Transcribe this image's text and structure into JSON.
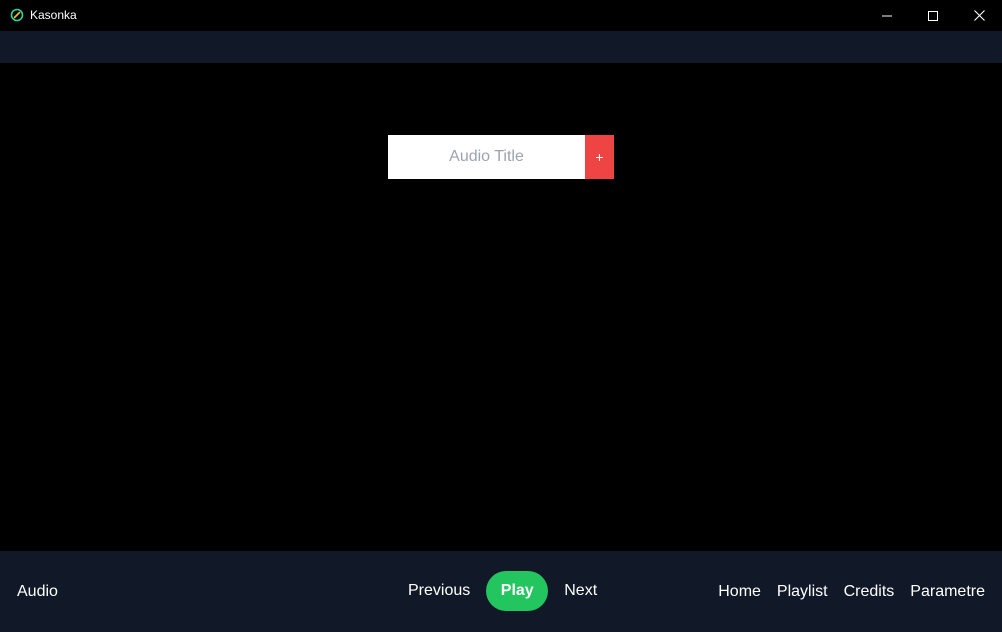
{
  "window": {
    "title": "Kasonka",
    "icon": "app-link-icon",
    "controls": [
      "minimize-icon",
      "maximize-icon",
      "close-icon"
    ]
  },
  "add_form": {
    "title_placeholder": "Audio Title",
    "title_value": "",
    "add_label": "+"
  },
  "bottom_bar": {
    "section_label": "Audio",
    "player": {
      "previous_label": "Previous",
      "play_label": "Play",
      "next_label": "Next"
    },
    "nav": [
      {
        "label": "Home"
      },
      {
        "label": "Playlist"
      },
      {
        "label": "Credits"
      },
      {
        "label": "Parametre"
      }
    ]
  },
  "colors": {
    "background": "#000000",
    "bar": "#111827",
    "play": "#22c55e",
    "add": "#ef4444",
    "placeholder": "#9ca3af"
  }
}
